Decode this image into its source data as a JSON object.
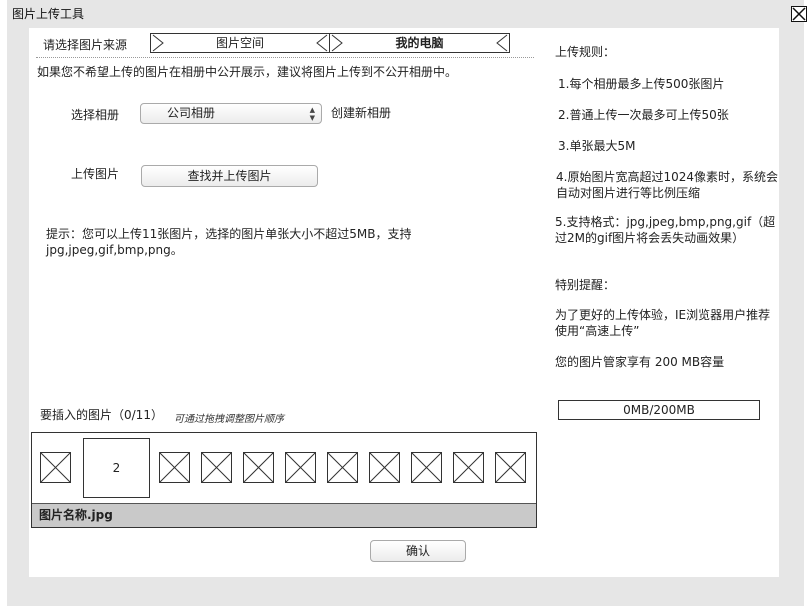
{
  "dialog": {
    "title": "图片上传工具"
  },
  "source": {
    "label": "请选择图片来源",
    "tabs": [
      "图片空间",
      "我的电脑"
    ]
  },
  "notice": "如果您不希望上传的图片在相册中公开展示，建议将图片上传到不公开相册中。",
  "album": {
    "label": "选择相册",
    "selected": "公司相册",
    "create_link": "创建新相册"
  },
  "upload": {
    "label": "上传图片",
    "button": "查找并上传图片"
  },
  "hint": "提示：您可以上传11张图片，选择的图片单张大小不超过5MB，支持jpg,jpeg,gif,bmp,png。",
  "insert": {
    "label": "要插入的图片（0/11）",
    "sub": "可通过拖拽调整图片顺序",
    "selected_thumb": "2",
    "filename": "图片名称.jpg"
  },
  "confirm_button": "确认",
  "rules": {
    "title": "上传规则：",
    "items": [
      "1.每个相册最多上传500张图片",
      "2.普通上传一次最多可上传50张",
      "3.单张最大5M",
      "4.原始图片宽高超过1024像素时，系统会自动对图片进行等比例压缩",
      "5.支持格式：jpg,jpeg,bmp,png,gif（超过2M的gif图片将会丢失动画效果）"
    ],
    "special_title": "特别提醒：",
    "special_text": "为了更好的上传体验，IE浏览器用户推荐使用“高速上传”",
    "capacity_text": "您的图片管家享有 200 MB容量"
  },
  "storage": "0MB/200MB",
  "icons": {
    "close": "close-icon",
    "placeholder": "image-placeholder-icon",
    "select_arrows": "updown-arrows-icon"
  }
}
